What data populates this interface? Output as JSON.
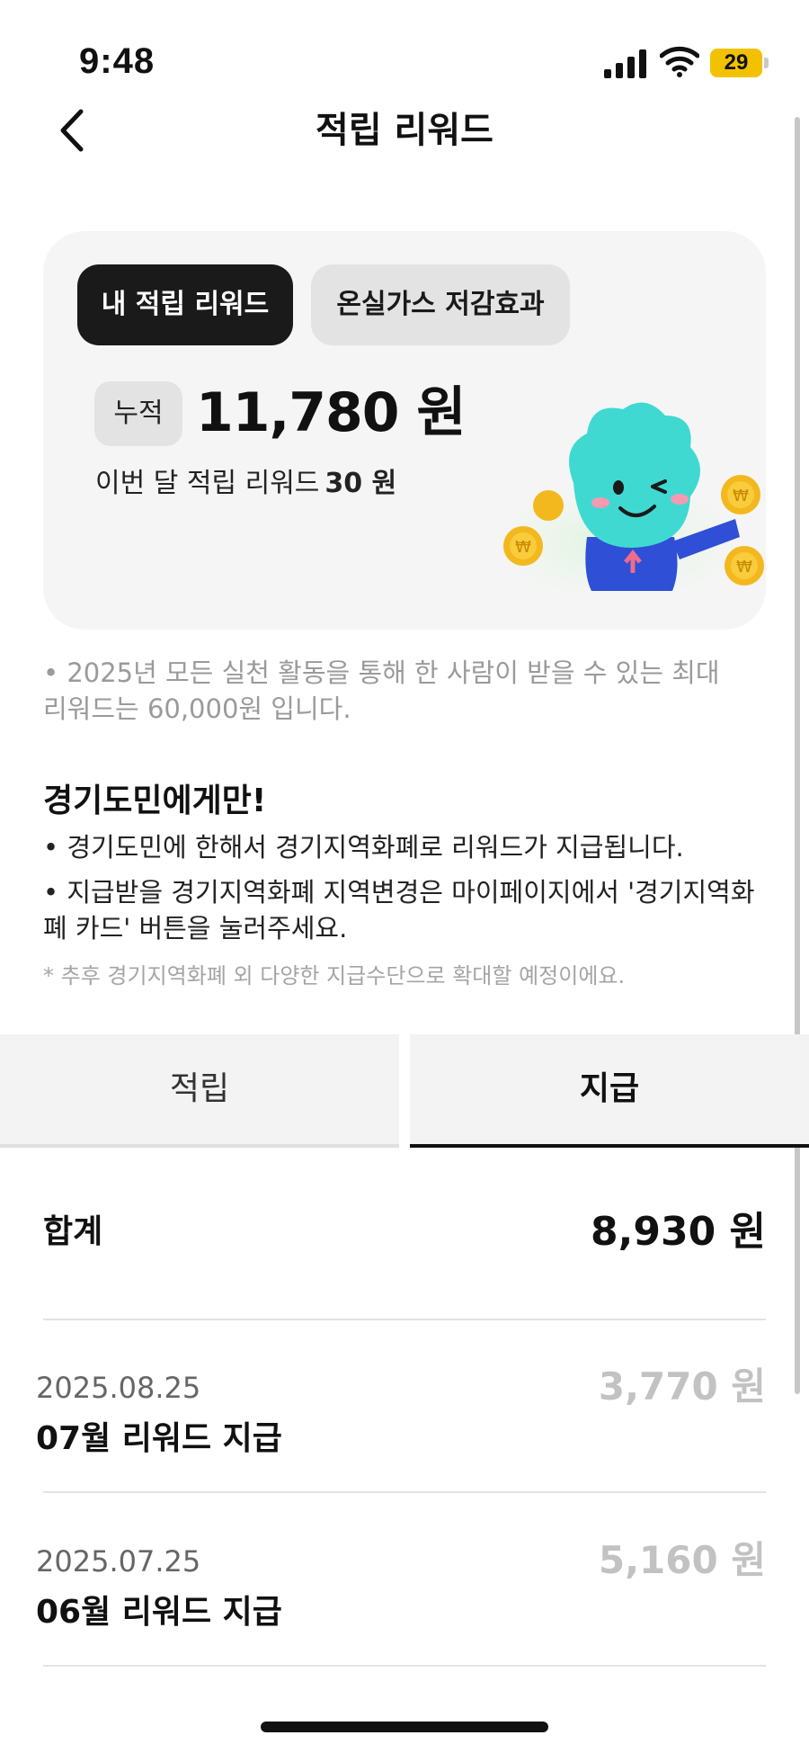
{
  "status_bar": {
    "time": "9:48",
    "battery": "29"
  },
  "nav": {
    "title": "적립 리워드"
  },
  "card": {
    "tabs": [
      "내 적립 리워드",
      "온실가스 저감효과"
    ],
    "accumulated_label": "누적",
    "accumulated_amount": "11,780 원",
    "this_month_label": "이번 달 적립 리워드",
    "this_month_value": "30 원"
  },
  "notes": {
    "max_reward": "• 2025년 모든 실천 활동을 통해 한 사람이 받을 수 있는 최대 리워드는 60,000원 입니다.",
    "section_title": "경기도민에게만!",
    "line1": "• 경기도민에 한해서 경기지역화폐로 리워드가 지급됩니다.",
    "line2": "• 지급받을 경기지역화폐 지역변경은 마이페이지에서 '경기지역화폐 카드' 버튼을 눌러주세요.",
    "footnote": "* 추후 경기지역화폐 외 다양한 지급수단으로 확대할 예정이에요."
  },
  "tabs": {
    "accrual": "적립",
    "payment": "지급",
    "active": "지급"
  },
  "total": {
    "label": "합계",
    "value": "8,930 원"
  },
  "items": [
    {
      "date": "2025.08.25",
      "title": "07월 리워드 지급",
      "amount": "3,770 원"
    },
    {
      "date": "2025.07.25",
      "title": "06월 리워드 지급",
      "amount": "5,160 원"
    }
  ],
  "colors": {
    "active_tab": "#1a1a1a",
    "muted_amount": "#c2c2c2",
    "mascot": "#3fd9d2",
    "battery": "#f2c200"
  },
  "icons": [
    "back-chevron-icon",
    "signal-icon",
    "wifi-icon",
    "battery-icon",
    "mascot-illustration"
  ]
}
